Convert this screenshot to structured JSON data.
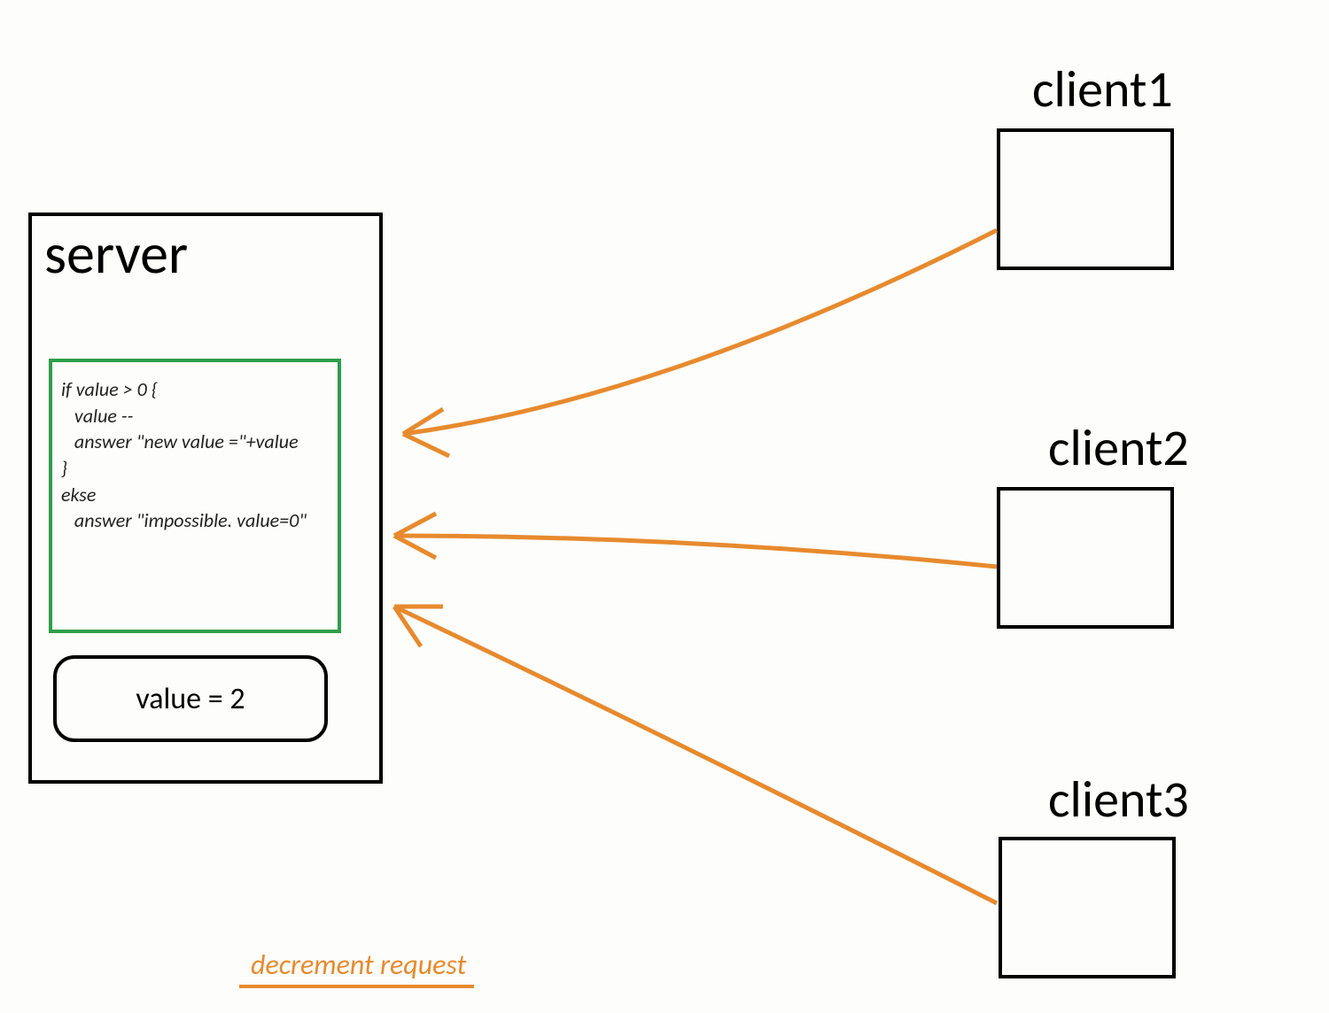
{
  "server": {
    "title": "server",
    "code": "if value > 0 {\n   value --\n   answer \"new value =\"+value\n}\nekse\n   answer \"impossible. value=0\"",
    "value_label": "value = 2"
  },
  "clients": {
    "c1": "client1",
    "c2": "client2",
    "c3": "client3"
  },
  "legend": "decrement request",
  "colors": {
    "arrow": "#e78a2e",
    "code_border": "#2e9e4a"
  }
}
